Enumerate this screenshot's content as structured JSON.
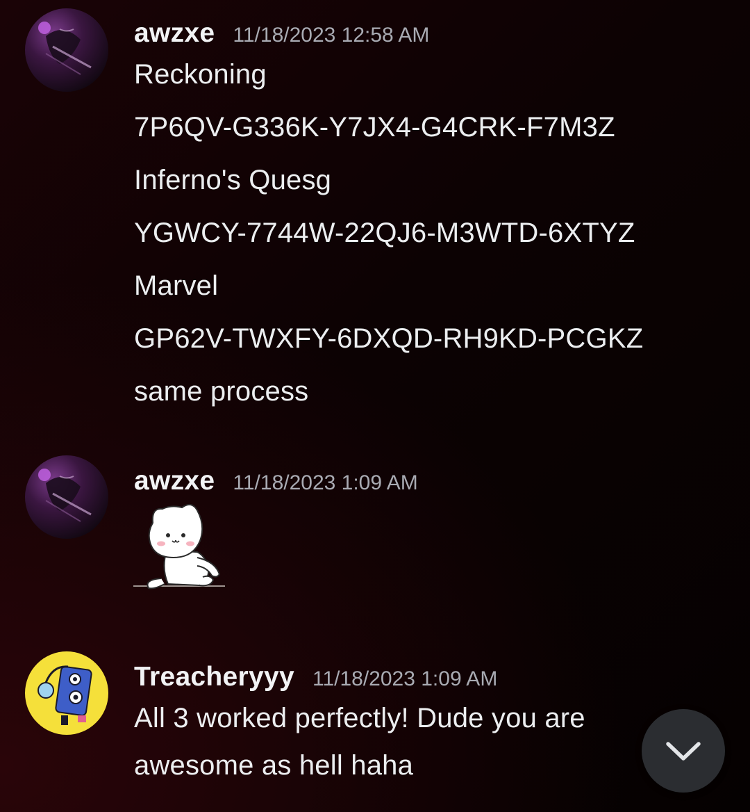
{
  "messages": [
    {
      "author": "awzxe",
      "timestamp": "11/18/2023 12:58 AM",
      "lines": [
        "Reckoning",
        "7P6QV-G336K-Y7JX4-G4CRK-F7M3Z",
        "Inferno's Quesg",
        "YGWCY-7744W-22QJ6-M3WTD-6XTYZ",
        "Marvel",
        "GP62V-TWXFY-6DXQD-RH9KD-PCGKZ",
        "same process"
      ]
    },
    {
      "author": "awzxe",
      "timestamp": "11/18/2023 1:09 AM",
      "sticker": "white-cat-sticker"
    },
    {
      "author": "Treacheryyy",
      "timestamp": "11/18/2023 1:09 AM",
      "lines": [
        "All 3 worked perfectly! Dude you are",
        "awesome as hell haha"
      ]
    }
  ],
  "icons": {
    "scroll_down": "chevron-down-icon"
  },
  "colors": {
    "background": "#0a0203",
    "text": "#f2f3f5",
    "timestamp": "#a9abb3",
    "scroll_button": "#2b2d31",
    "avatar2_bg": "#f5e03a"
  }
}
